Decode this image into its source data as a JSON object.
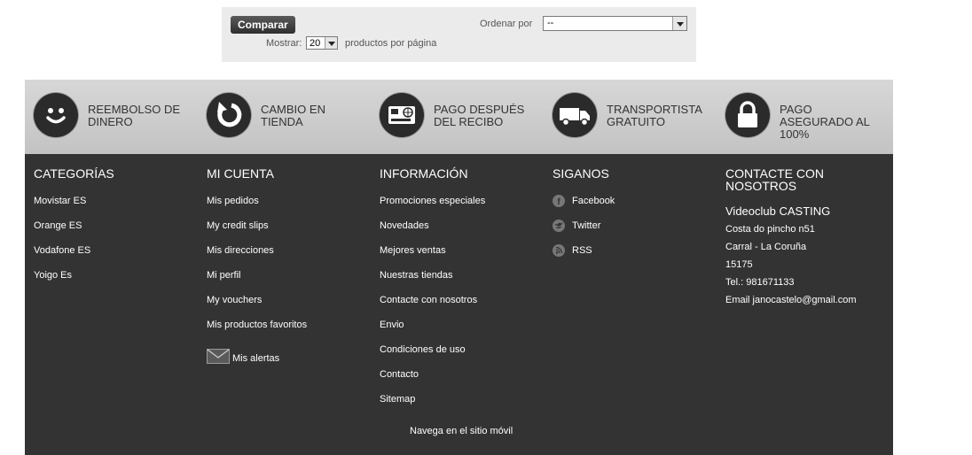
{
  "toolbar": {
    "compare_label": "Comparar",
    "show_label": "Mostrar:",
    "show_value": "20",
    "per_page_label": "productos por página",
    "sort_label": "Ordenar por",
    "sort_value": "--"
  },
  "reassurance": [
    {
      "label": "Reembolso de dinero",
      "icon": "smiley-icon"
    },
    {
      "label": "Cambio en tienda",
      "icon": "exchange-arrow-icon"
    },
    {
      "label": "Pago después del recibo",
      "icon": "payment-card-icon"
    },
    {
      "label": "Transportista gratuito",
      "icon": "truck-icon"
    },
    {
      "label": "Pago asegurado al 100%",
      "icon": "lock-icon"
    }
  ],
  "footer": {
    "categories": {
      "title": "Categorías",
      "items": [
        "Movistar ES",
        "Orange ES",
        "Vodafone ES",
        "Yoigo Es"
      ]
    },
    "account": {
      "title": "Mi cuenta",
      "items": [
        "Mis pedidos",
        "My credit slips",
        "Mis direcciones",
        "Mi perfil",
        "My vouchers",
        "Mis productos favoritos"
      ],
      "alerts_label": "Mis alertas"
    },
    "info": {
      "title": "Información",
      "items": [
        "Promociones especiales",
        "Novedades",
        "Mejores ventas",
        "Nuestras tiendas",
        "Contacte con nosotros",
        "Envio",
        "Condiciones de uso",
        "Contacto",
        "Sitemap"
      ]
    },
    "social": {
      "title": "Siganos",
      "items": [
        "Facebook",
        "Twitter",
        "RSS"
      ]
    },
    "contact": {
      "title": "Contacte con nosotros",
      "name": "Videoclub CASTING",
      "address1": "Costa do pincho n51",
      "address2": "Carral - La Coruña",
      "postcode": "15175",
      "phone": "Tel.: 981671133",
      "email": "Email janocastelo@gmail.com"
    },
    "mobile_link": "Navega en el sitio móvil"
  },
  "colors": {
    "footer_bg": "#333333",
    "band_bg": "#cfcfcf",
    "toolbar_bg": "#ebebeb"
  }
}
